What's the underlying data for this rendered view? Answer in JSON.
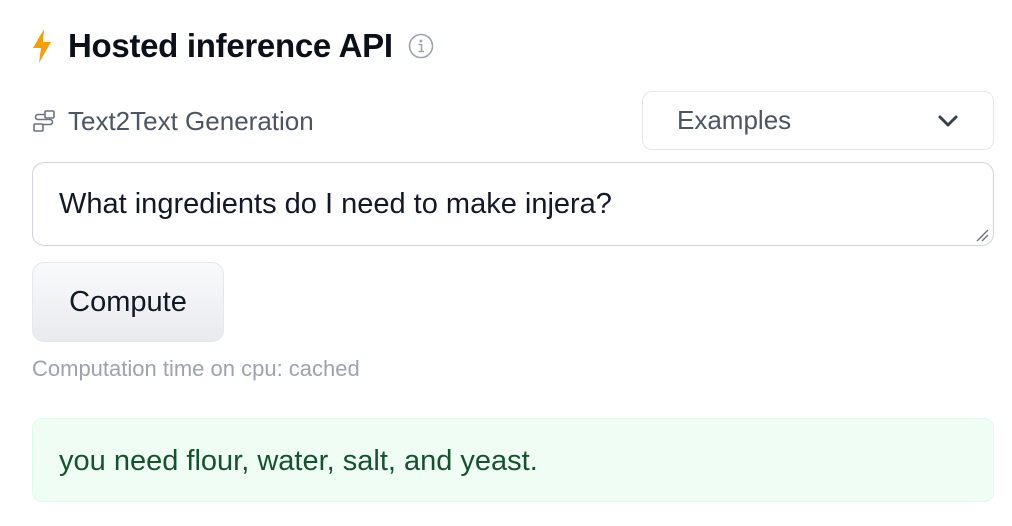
{
  "header": {
    "title": "Hosted inference API",
    "icon": "lightning-bolt-icon",
    "info_icon": "info-icon",
    "accent_color": "#f59e0b"
  },
  "task": {
    "icon": "text2text-task-icon",
    "label": "Text2Text Generation"
  },
  "examples": {
    "label": "Examples",
    "icon": "chevron-down-icon"
  },
  "input": {
    "value": "What ingredients do I need to make injera?"
  },
  "compute": {
    "label": "Compute"
  },
  "status": {
    "computation_text": "Computation time on cpu: cached"
  },
  "output": {
    "text": "you need flour, water, salt, and yeast.",
    "background_color": "#f0fdf4",
    "text_color": "#14532d"
  }
}
